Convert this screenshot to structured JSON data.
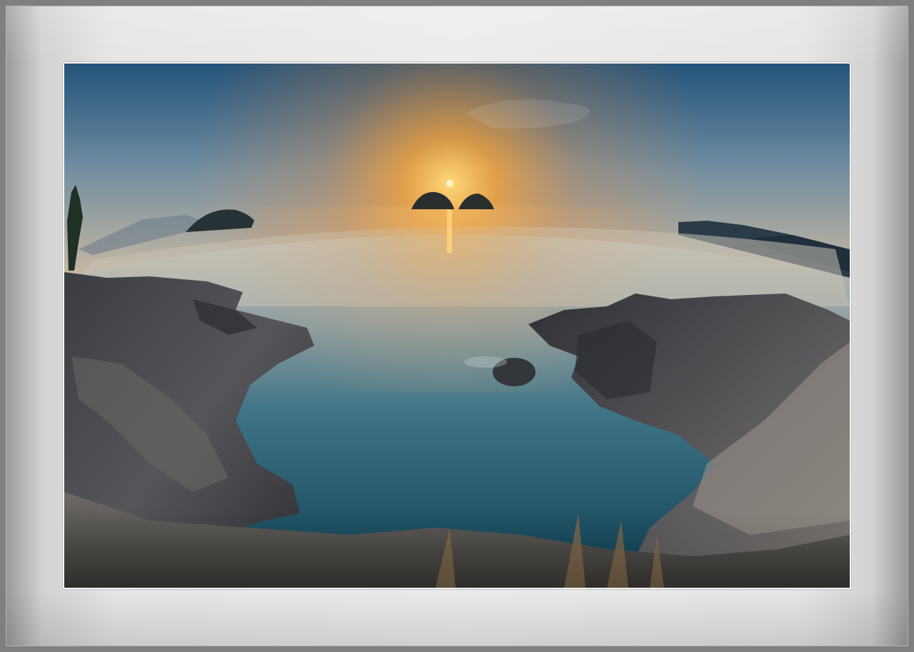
{
  "image": {
    "subject": "",
    "colors": {
      "sky_top": "#2c6390",
      "sky_glow": "#f3a23c",
      "sun": "#fff4c8",
      "sea_far": "#c5c3b8",
      "sea_near": "#0f4e63",
      "rock_dark": "#2d2e33",
      "rock_light": "#8a8682",
      "mat_light": "#ececec",
      "mat_dark": "#8d8d8d"
    }
  }
}
